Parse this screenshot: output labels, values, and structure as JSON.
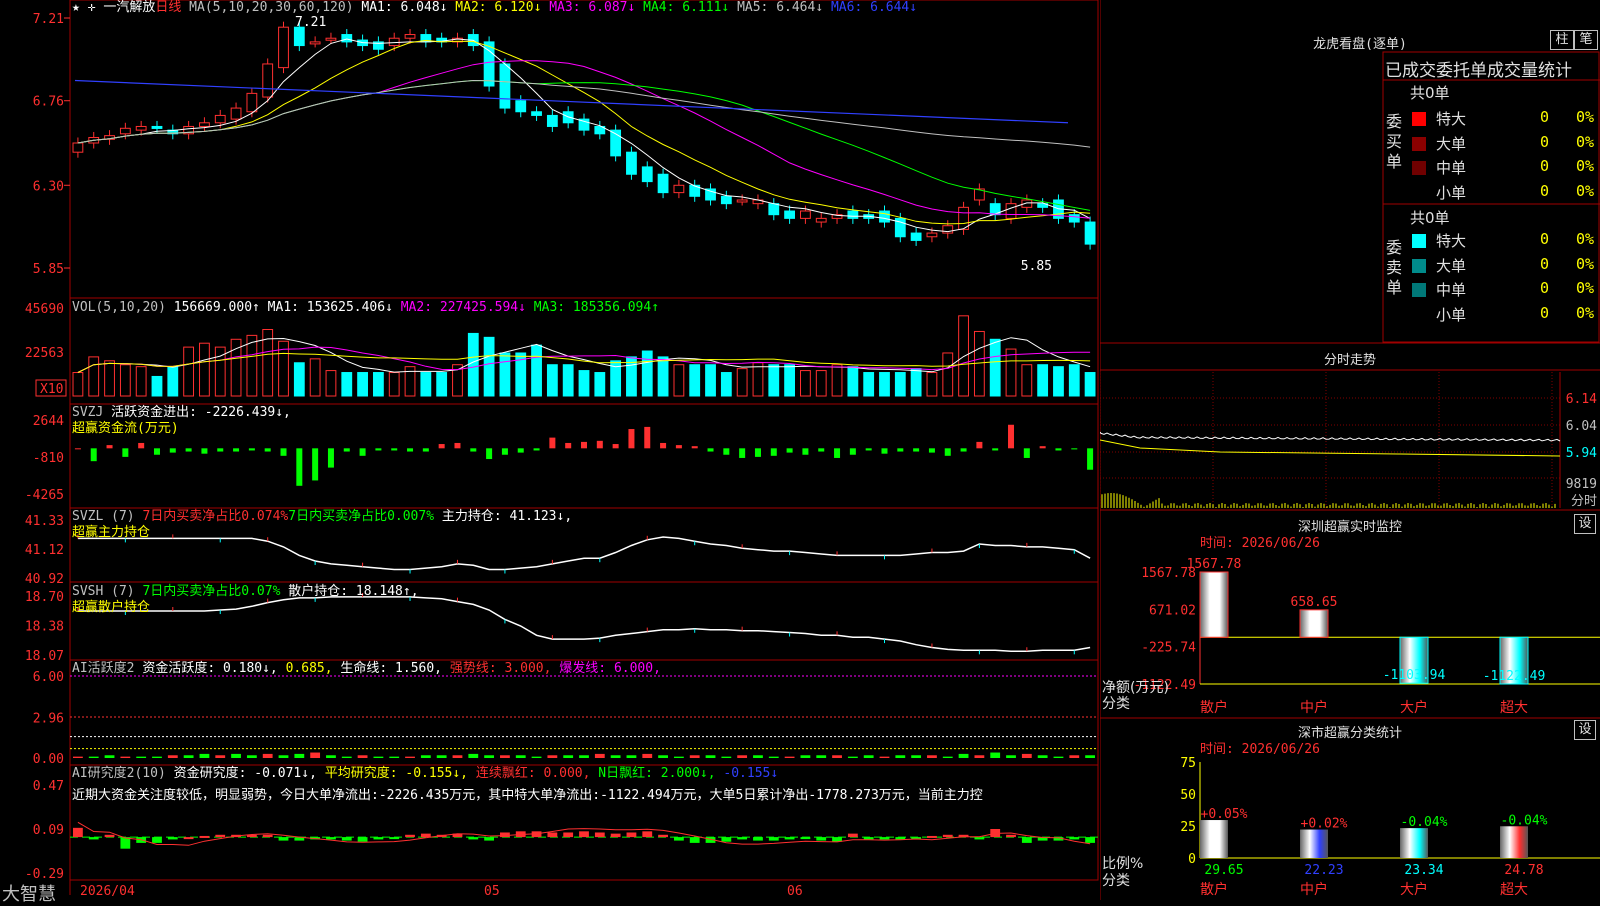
{
  "stock": {
    "name": "一汽解放",
    "period": "日线"
  },
  "main": {
    "ma_params": "MA(5,10,20,30,60,120)",
    "ma_values": [
      {
        "label": "MA1: 6.048↓",
        "color": "#ffffff"
      },
      {
        "label": "MA2: 6.120↓",
        "color": "#ffff00"
      },
      {
        "label": "MA3: 6.087↓",
        "color": "#ff00ff"
      },
      {
        "label": "MA4: 6.111↓",
        "color": "#00ff00"
      },
      {
        "label": "MA5: 6.464↓",
        "color": "#c0c0c0"
      },
      {
        "label": "MA6: 6.644↓",
        "color": "#3040ff"
      }
    ],
    "yticks": [
      "7.21",
      "6.76",
      "6.30",
      "5.85"
    ],
    "high_mark": "7.21",
    "low_mark": "5.85"
  },
  "vol": {
    "params": "VOL(5,10,20)",
    "value": "156669.000↑",
    "ma": [
      {
        "label": "MA1: 153625.406↓",
        "color": "#ffffff"
      },
      {
        "label": "MA2: 227425.594↓",
        "color": "#ff00ff"
      },
      {
        "label": "MA3: 185356.094↑",
        "color": "#00ff00"
      }
    ],
    "yticks": [
      "45690",
      "22563"
    ],
    "unit": "X10"
  },
  "svzj": {
    "name": "SVZJ",
    "text": "活跃资金进出: -2226.439↓,",
    "sub": "超赢资金流(万元)",
    "yticks": [
      "2644",
      "-810",
      "-4265"
    ]
  },
  "svzl": {
    "name": "SVZL (7)",
    "t1": "7日内买卖净占比0.074%",
    "t2": "7日内买卖净占比0.007%",
    "t3": "主力持仓: 41.123↓,",
    "sub": "超赢主力持仓",
    "yticks": [
      "41.33",
      "41.12",
      "40.92"
    ]
  },
  "svsh": {
    "name": "SVSH (7)",
    "t1": "7日内买卖净占比0.07%",
    "t2": "散户持仓: 18.148↑,",
    "sub": "超赢散户持仓",
    "yticks": [
      "18.70",
      "18.38",
      "18.07"
    ]
  },
  "ai1": {
    "name": "AI活跃度2",
    "t1": "资金活跃度: 0.180↓,",
    "t2": "0.685,",
    "t3": "生命线: 1.560,",
    "t4": "强势线: 3.000,",
    "t5": "爆发线: 6.000,",
    "yticks": [
      "6.00",
      "2.96",
      "0.00"
    ]
  },
  "ai2": {
    "name": "AI研究度2(10)",
    "t1": "资金研究度: -0.071↓,",
    "t2": "平均研究度: -0.155↓,",
    "t3": "连续飘红: 0.000,",
    "t4": "N日飘红: 2.000↓,",
    "t5": "-0.155↓",
    "note": "近期大资金关注度较低，明显弱势，今日大单净流出:-2226.435万元，其中特大单净流出:-1122.494万元，大单5日累计净出-1778.273万元，当前主力控",
    "yticks": [
      "0.47",
      "0.09",
      "-0.29"
    ]
  },
  "xaxis": {
    "labels": [
      "2026/04",
      "05",
      "06"
    ]
  },
  "brand": "大智慧",
  "right": {
    "lhb_title": "龙虎看盘(逐单)",
    "btn_zhu": "柱",
    "btn_bi": "笔",
    "stat_title": "已成交委托单成交量统计",
    "buy": {
      "side": "委买单",
      "count": "共0单",
      "rows": [
        {
          "name": "特大",
          "color": "#ff0000",
          "v": "0",
          "p": "0%"
        },
        {
          "name": "大单",
          "color": "#8b0000",
          "v": "0",
          "p": "0%"
        },
        {
          "name": "中单",
          "color": "#700000",
          "v": "0",
          "p": "0%"
        },
        {
          "name": "小单",
          "color": "#000000",
          "v": "0",
          "p": "0%"
        }
      ]
    },
    "sell": {
      "side": "委卖单",
      "count": "共0单",
      "rows": [
        {
          "name": "特大",
          "color": "#00ffff",
          "v": "0",
          "p": "0%"
        },
        {
          "name": "大单",
          "color": "#008b8b",
          "v": "0",
          "p": "0%"
        },
        {
          "name": "中单",
          "color": "#007878",
          "v": "0",
          "p": "0%"
        },
        {
          "name": "小单",
          "color": "#000000",
          "v": "0",
          "p": "0%"
        }
      ]
    },
    "fs": {
      "title": "分时走势",
      "yticks": [
        "6.14",
        "6.04",
        "5.94"
      ],
      "vol": "9819",
      "vol_unit": "分时"
    },
    "mon": {
      "title": "深圳超赢实时监控",
      "btn": "设",
      "time": "时间: 2026/06/26",
      "yticks": [
        "1567.78",
        "671.02",
        "-225.74",
        "-1122.49"
      ],
      "ylabel": "净额(万元)",
      "xlabel": "分类",
      "bars": [
        {
          "cat": "散户",
          "value": 1567.78,
          "label": "1567.78"
        },
        {
          "cat": "中户",
          "value": 658.65,
          "label": "658.65"
        },
        {
          "cat": "大户",
          "value": -1103.94,
          "label": "-1103.94"
        },
        {
          "cat": "超大",
          "value": -1122.49,
          "label": "-1122.49"
        }
      ]
    },
    "cls": {
      "title": "深市超赢分类统计",
      "btn": "设",
      "time": "时间: 2026/06/26",
      "yticks": [
        "75",
        "50",
        "25",
        "0"
      ],
      "ylabel": "比例%",
      "xlabel": "分类",
      "bars": [
        {
          "cat": "散户",
          "value": 29.65,
          "chg": "+0.05%"
        },
        {
          "cat": "中户",
          "value": 22.23,
          "chg": "+0.02%"
        },
        {
          "cat": "大户",
          "value": 23.34,
          "chg": "-0.04%"
        },
        {
          "cat": "超大",
          "value": 24.78,
          "chg": "-0.04%"
        }
      ]
    }
  },
  "chart_data": [
    {
      "type": "candlestick",
      "title": "一汽解放 日线",
      "ylim": [
        5.85,
        7.21
      ],
      "series": [
        {
          "open": [
            6.48,
            6.53,
            6.55,
            6.58,
            6.6,
            6.62,
            6.6,
            6.58,
            6.62,
            6.64,
            6.66,
            6.7,
            6.78,
            6.94,
            7.16,
            7.08,
            7.1,
            7.12,
            7.09,
            7.08,
            7.06,
            7.1,
            7.12,
            7.1,
            7.08,
            7.12,
            7.08,
            6.96,
            6.76,
            6.7,
            6.68,
            6.7,
            6.66,
            6.62,
            6.6,
            6.48,
            6.4,
            6.36,
            6.26,
            6.3,
            6.28,
            6.24,
            6.22,
            6.2,
            6.2,
            6.16,
            6.12,
            6.1,
            6.12,
            6.16,
            6.14,
            6.16,
            6.12,
            6.04,
            6.02,
            6.04,
            6.06,
            6.22,
            6.2,
            6.12,
            6.18,
            6.2,
            6.22,
            6.14,
            6.1
          ]
        },
        {
          "close": [
            6.53,
            6.56,
            6.57,
            6.61,
            6.62,
            6.61,
            6.58,
            6.62,
            6.64,
            6.68,
            6.72,
            6.8,
            6.96,
            7.16,
            7.06,
            7.08,
            7.1,
            7.08,
            7.06,
            7.04,
            7.1,
            7.12,
            7.08,
            7.08,
            7.1,
            7.06,
            6.84,
            6.72,
            6.7,
            6.68,
            6.62,
            6.64,
            6.6,
            6.58,
            6.46,
            6.36,
            6.32,
            6.26,
            6.3,
            6.24,
            6.22,
            6.2,
            6.22,
            6.22,
            6.14,
            6.12,
            6.16,
            6.12,
            6.14,
            6.12,
            6.12,
            6.1,
            6.02,
            6.0,
            6.04,
            6.08,
            6.18,
            6.28,
            6.14,
            6.2,
            6.22,
            6.18,
            6.12,
            6.1,
            5.98
          ]
        }
      ]
    },
    {
      "type": "bar",
      "title": "VOL(5,10,20)",
      "ylim": [
        0,
        45690
      ],
      "series": [
        {
          "name": "VOL",
          "values": [
            12,
            20,
            18,
            16,
            15,
            10,
            15,
            25,
            27,
            25,
            29,
            31,
            34,
            28,
            17,
            19,
            13,
            12,
            12,
            12,
            12,
            15,
            12,
            12,
            16,
            32,
            30,
            22,
            22,
            26,
            16,
            16,
            13,
            12,
            18,
            20,
            23,
            20,
            16,
            16,
            16,
            12,
            14,
            17,
            16,
            16,
            13,
            13,
            16,
            15,
            12,
            12,
            12,
            14,
            12,
            22,
            41,
            33,
            29,
            24,
            16,
            16,
            15,
            16,
            12
          ]
        }
      ]
    },
    {
      "type": "bar",
      "title": "超赢资金流(万元)",
      "ylim": [
        -4265,
        2644
      ],
      "series": [
        {
          "name": "SVZJ",
          "values": [
            0,
            -1200,
            300,
            -800,
            500,
            -600,
            -400,
            -300,
            -500,
            -300,
            -300,
            -200,
            -300,
            -700,
            -3500,
            -3000,
            -1800,
            -300,
            -700,
            -200,
            -200,
            -300,
            -300,
            400,
            500,
            -300,
            -1000,
            -600,
            -400,
            -200,
            1000,
            500,
            600,
            700,
            400,
            1800,
            2000,
            500,
            300,
            200,
            -300,
            -600,
            -900,
            -800,
            -700,
            -400,
            -600,
            -300,
            -900,
            -600,
            -200,
            -500,
            -300,
            -300,
            -400,
            -700,
            -300,
            600,
            -200,
            2200,
            -900,
            200,
            -200,
            -100,
            -2000
          ]
        }
      ]
    },
    {
      "type": "line",
      "title": "超赢主力持仓",
      "ylim": [
        40.92,
        41.33
      ],
      "series": [
        {
          "name": "主力持仓",
          "values": [
            41.2,
            41.2,
            41.2,
            41.2,
            41.2,
            41.2,
            41.2,
            41.2,
            41.2,
            41.2,
            41.2,
            41.2,
            41.18,
            41.14,
            41.08,
            41.04,
            41.02,
            41.01,
            41.0,
            40.99,
            40.98,
            40.98,
            40.99,
            41.0,
            41.02,
            41.01,
            40.98,
            40.98,
            40.99,
            41.0,
            41.02,
            41.04,
            41.06,
            41.06,
            41.1,
            41.15,
            41.19,
            41.21,
            41.2,
            41.18,
            41.16,
            41.15,
            41.13,
            41.12,
            41.11,
            41.11,
            41.1,
            41.09,
            41.08,
            41.08,
            41.08,
            41.08,
            41.08,
            41.09,
            41.1,
            41.1,
            41.11,
            41.16,
            41.15,
            41.15,
            41.14,
            41.14,
            41.13,
            41.12,
            41.06
          ]
        }
      ]
    },
    {
      "type": "line",
      "title": "超赢散户持仓",
      "ylim": [
        18.07,
        18.7
      ],
      "series": [
        {
          "name": "散户持仓",
          "values": [
            18.54,
            18.54,
            18.54,
            18.54,
            18.54,
            18.54,
            18.54,
            18.54,
            18.54,
            18.55,
            18.56,
            18.59,
            18.63,
            18.66,
            18.68,
            18.68,
            18.69,
            18.69,
            18.69,
            18.69,
            18.69,
            18.69,
            18.68,
            18.67,
            18.64,
            18.61,
            18.55,
            18.45,
            18.38,
            18.28,
            18.24,
            18.24,
            18.24,
            18.25,
            18.28,
            18.3,
            18.32,
            18.34,
            18.34,
            18.35,
            18.34,
            18.34,
            18.33,
            18.33,
            18.32,
            18.31,
            18.3,
            18.28,
            18.28,
            18.26,
            18.26,
            18.24,
            18.22,
            18.18,
            18.15,
            18.13,
            18.12,
            18.12,
            18.12,
            18.11,
            18.11,
            18.12,
            18.12,
            18.12,
            18.15
          ]
        }
      ]
    },
    {
      "type": "bar",
      "title": "AI活跃度2",
      "ylim": [
        0,
        6.0
      ],
      "series": [
        {
          "name": "资金活跃度",
          "values": [
            0.1,
            0.1,
            0.2,
            0.1,
            0.1,
            0.1,
            0.2,
            0.2,
            0.3,
            0.2,
            0.3,
            0.2,
            0.3,
            0.2,
            0.3,
            0.4,
            0.2,
            0.1,
            0.2,
            0.1,
            0.1,
            0.1,
            0.2,
            0.2,
            0.2,
            0.3,
            0.2,
            0.2,
            0.2,
            0.1,
            0.2,
            0.2,
            0.2,
            0.3,
            0.2,
            0.2,
            0.3,
            0.2,
            0.1,
            0.2,
            0.2,
            0.1,
            0.2,
            0.2,
            0.1,
            0.1,
            0.2,
            0.2,
            0.2,
            0.1,
            0.2,
            0.1,
            0.2,
            0.2,
            0.2,
            0.1,
            0.3,
            0.2,
            0.4,
            0.2,
            0.3,
            0.2,
            0.1,
            0.2,
            0.2
          ]
        }
      ]
    },
    {
      "type": "bar",
      "title": "AI研究度2(10)",
      "ylim": [
        -0.29,
        0.47
      ],
      "series": [
        {
          "name": "资金研究度",
          "values": [
            0.08,
            -0.02,
            0.02,
            -0.1,
            -0.05,
            -0.05,
            -0.02,
            0.0,
            0.01,
            0.02,
            0.02,
            0.02,
            0.02,
            -0.03,
            -0.03,
            -0.02,
            -0.02,
            -0.03,
            -0.04,
            -0.02,
            -0.01,
            0.02,
            0.03,
            0.02,
            0.03,
            -0.02,
            -0.03,
            0.04,
            0.05,
            0.05,
            0.04,
            0.04,
            0.05,
            0.04,
            0.03,
            0.04,
            0.05,
            0.02,
            -0.03,
            -0.05,
            -0.05,
            -0.04,
            -0.02,
            -0.03,
            -0.03,
            -0.02,
            -0.01,
            -0.03,
            -0.04,
            0.03,
            -0.02,
            -0.02,
            -0.02,
            -0.02,
            0.01,
            0.02,
            0.02,
            -0.02,
            0.07,
            0.02,
            -0.05,
            -0.03,
            -0.03,
            -0.02,
            -0.05
          ]
        }
      ]
    },
    {
      "type": "bar",
      "title": "深圳超赢实时监控",
      "ylabel": "净额(万元)",
      "xlabel": "分类",
      "ylim": [
        -1122.49,
        1567.78
      ],
      "categories": [
        "散户",
        "中户",
        "大户",
        "超大"
      ],
      "values": [
        1567.78,
        658.65,
        -1103.94,
        -1122.49
      ]
    },
    {
      "type": "bar",
      "title": "深市超赢分类统计",
      "ylabel": "比例%",
      "xlabel": "分类",
      "ylim": [
        0,
        75
      ],
      "categories": [
        "散户",
        "中户",
        "大户",
        "超大"
      ],
      "values": [
        29.65,
        22.23,
        23.34,
        24.78
      ]
    }
  ]
}
